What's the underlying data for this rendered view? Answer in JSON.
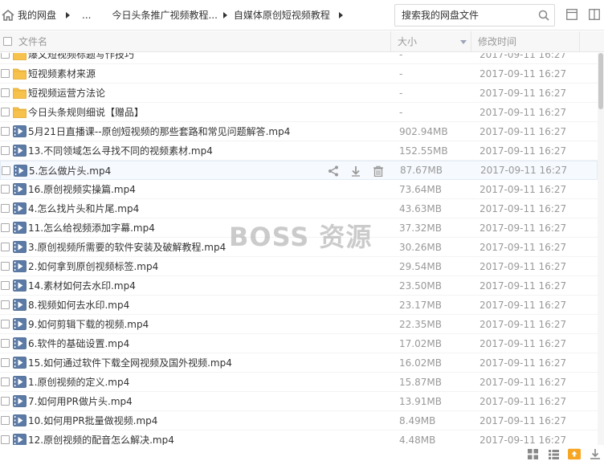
{
  "breadcrumb": {
    "items": [
      {
        "label": "我的网盘"
      },
      {
        "label": "..."
      },
      {
        "label": "今日头条推广视频教程..."
      },
      {
        "label": "自媒体原创短视频教程"
      }
    ]
  },
  "search": {
    "placeholder": "搜索我的网盘文件"
  },
  "columns": {
    "name": "文件名",
    "size": "大小",
    "time": "修改时间"
  },
  "watermark": "BOSS 资源",
  "accent": "#3b8cd9",
  "folder_color": "#f7c24b",
  "video_icon_color": "#4c6f9c",
  "files": [
    {
      "type": "folder",
      "name": "爆文短视频标题写作技巧",
      "size": "-",
      "time": "2017-09-11 16:27"
    },
    {
      "type": "folder",
      "name": "短视频素材来源",
      "size": "-",
      "time": "2017-09-11 16:27"
    },
    {
      "type": "folder",
      "name": "短视频运营方法论",
      "size": "-",
      "time": "2017-09-11 16:27"
    },
    {
      "type": "folder",
      "name": "今日头条规则细说【赠品】",
      "size": "-",
      "time": "2017-09-11 16:27"
    },
    {
      "type": "video",
      "name": "5月21日直播课--原创短视频的那些套路和常见问题解答.mp4",
      "size": "902.94MB",
      "time": "2017-09-11 16:27"
    },
    {
      "type": "video",
      "name": "13.不同领域怎么寻找不同的视频素材.mp4",
      "size": "152.55MB",
      "time": "2017-09-11 16:27"
    },
    {
      "type": "video",
      "name": "5.怎么做片头.mp4",
      "size": "87.67MB",
      "time": "2017-09-11 16:27",
      "hover": true
    },
    {
      "type": "video",
      "name": "16.原创视频实操篇.mp4",
      "size": "73.64MB",
      "time": "2017-09-11 16:27"
    },
    {
      "type": "video",
      "name": "4.怎么找片头和片尾.mp4",
      "size": "43.63MB",
      "time": "2017-09-11 16:27"
    },
    {
      "type": "video",
      "name": "11.怎么给视频添加字幕.mp4",
      "size": "37.32MB",
      "time": "2017-09-11 16:27"
    },
    {
      "type": "video",
      "name": "3.原创视频所需要的软件安装及破解教程.mp4",
      "size": "30.26MB",
      "time": "2017-09-11 16:27"
    },
    {
      "type": "video",
      "name": "2.如何拿到原创视频标签.mp4",
      "size": "29.54MB",
      "time": "2017-09-11 16:27"
    },
    {
      "type": "video",
      "name": "14.素材如何去水印.mp4",
      "size": "23.50MB",
      "time": "2017-09-11 16:27"
    },
    {
      "type": "video",
      "name": "8.视频如何去水印.mp4",
      "size": "23.17MB",
      "time": "2017-09-11 16:27"
    },
    {
      "type": "video",
      "name": "9.如何剪辑下载的视频.mp4",
      "size": "22.35MB",
      "time": "2017-09-11 16:27"
    },
    {
      "type": "video",
      "name": "6.软件的基础设置.mp4",
      "size": "17.02MB",
      "time": "2017-09-11 16:27"
    },
    {
      "type": "video",
      "name": "15.如何通过软件下载全网视频及国外视频.mp4",
      "size": "16.02MB",
      "time": "2017-09-11 16:27"
    },
    {
      "type": "video",
      "name": "1.原创视频的定义.mp4",
      "size": "15.87MB",
      "time": "2017-09-11 16:27"
    },
    {
      "type": "video",
      "name": "7.如何用PR做片头.mp4",
      "size": "13.91MB",
      "time": "2017-09-11 16:27"
    },
    {
      "type": "video",
      "name": "10.如何用PR批量做视频.mp4",
      "size": "8.49MB",
      "time": "2017-09-11 16:27"
    },
    {
      "type": "video",
      "name": "12.原创视频的配音怎么解决.mp4",
      "size": "4.48MB",
      "time": "2017-09-11 16:27"
    }
  ]
}
